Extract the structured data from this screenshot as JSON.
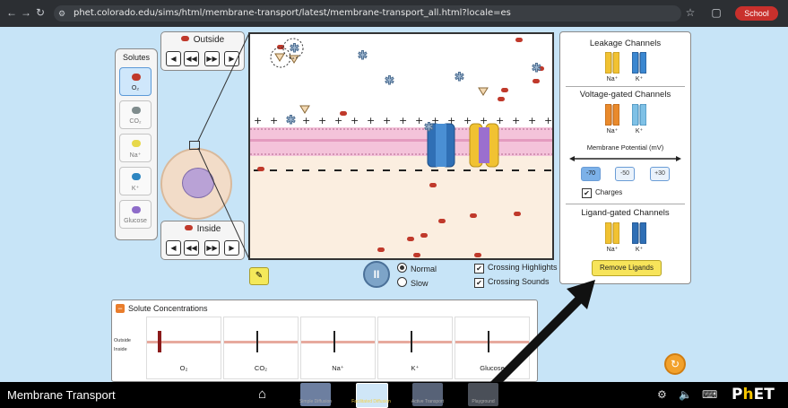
{
  "browser": {
    "url": "phet.colorado.edu/sims/html/membrane-transport/latest/membrane-transport_all.html?locale=es",
    "profile_label": "School"
  },
  "solutes_panel": {
    "title": "Solutes",
    "items": [
      {
        "label": "O₂",
        "color": "#c0392b",
        "selected": true
      },
      {
        "label": "CO₂",
        "color": "#7f8c8d",
        "selected": false
      },
      {
        "label": "Na⁺",
        "color": "#e7d84b",
        "selected": false
      },
      {
        "label": "K⁺",
        "color": "#2e86c1",
        "selected": false
      },
      {
        "label": "Glucose",
        "color": "#8e6cc9",
        "selected": false
      }
    ]
  },
  "outside_control": {
    "label": "Outside"
  },
  "inside_control": {
    "label": "Inside"
  },
  "right_panel": {
    "leakage_title": "Leakage Channels",
    "voltage_title": "Voltage-gated Channels",
    "ligand_title": "Ligand-gated Channels",
    "na_label": "Na⁺",
    "k_label": "K⁺",
    "membrane_potential_label": "Membrane Potential (mV)",
    "potential_options": [
      "-70",
      "-50",
      "+30"
    ],
    "selected_potential": "-70",
    "charges_label": "Charges",
    "charges_checked": true,
    "remove_ligands_label": "Remove Ligands"
  },
  "playback": {
    "speed_options": [
      "Normal",
      "Slow"
    ],
    "selected_speed": "Normal",
    "crossing_highlights_label": "Crossing Highlights",
    "crossing_sounds_label": "Crossing Sounds"
  },
  "concentrations": {
    "title": "Solute Concentrations",
    "outside_label": "Outside",
    "inside_label": "Inside",
    "items": [
      "O₂",
      "CO₂",
      "Na⁺",
      "K⁺",
      "Glucose"
    ]
  },
  "bottom_bar": {
    "app_title": "Membrane Transport",
    "screens": [
      "Simple Diffusion",
      "Facilitated Diffusion",
      "Active Transport",
      "Playground"
    ],
    "brand": "PhET"
  }
}
